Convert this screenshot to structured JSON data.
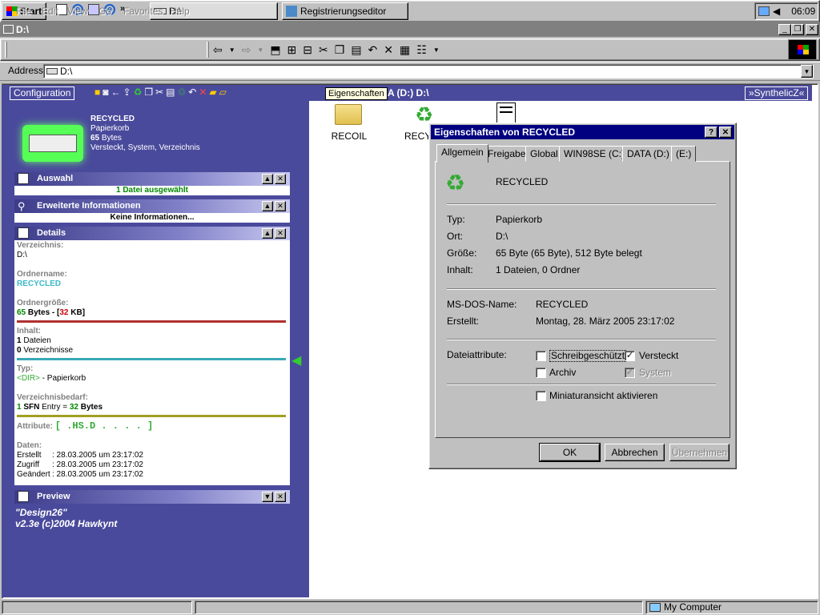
{
  "taskbar": {
    "start": "Start",
    "tasks": [
      "D:\\",
      "Registrierungseditor"
    ],
    "clock": "06:09"
  },
  "window": {
    "title": "D:\\"
  },
  "menu": [
    "File",
    "Edit",
    "View",
    "Go",
    "Favorites",
    "Help"
  ],
  "address": {
    "label": "Address",
    "value": "D:\\"
  },
  "band": {
    "config": "Configuration",
    "tooltip": "Eigenschaften",
    "path": "A (D:) D:\\",
    "synth": "»SynthelicZ«"
  },
  "folder": {
    "name": "RECYCLED",
    "type": "Papierkorb",
    "size_num": "65",
    "size_unit": "Bytes",
    "attrs": "Versteckt, System, Verzeichnis"
  },
  "panels": {
    "auswahl": {
      "title": "Auswahl",
      "text": "1 Datei ausgewählt"
    },
    "erweitert": {
      "title": "Erweiterte Informationen",
      "text": "Keine Informationen..."
    },
    "details": {
      "title": "Details",
      "verz_label": "Verzeichnis:",
      "verz_value": "D:\\",
      "name_label": "Ordnername:",
      "name_value": "RECYCLED",
      "groesse_label": "Ordnergröße:",
      "groesse_a": "65",
      "groesse_b": " Bytes - [",
      "groesse_c": "32",
      "groesse_d": " KB]",
      "inhalt_label": "Inhalt:",
      "inhalt_1a": "1",
      "inhalt_1b": " Dateien",
      "inhalt_2a": "0",
      "inhalt_2b": " Verzeichnisse",
      "typ_label": "Typ:",
      "typ_a": "<DIR>",
      "typ_b": " - Papierkorb",
      "bedarf_label": "Verzeichnisbedarf:",
      "bedarf_a": "1",
      "bedarf_b": " SFN ",
      "bedarf_c": "Entry = ",
      "bedarf_d": "32",
      "bedarf_e": " Bytes",
      "attr_label": "Attribute:",
      "attr_value": "[ .HS.D . . . . ]",
      "daten_label": "Daten:",
      "dates": [
        {
          "k": "Erstellt",
          "v": ": 28.03.2005 um 23:17:02"
        },
        {
          "k": "Zugriff",
          "v": ": 28.03.2005 um 23:17:02"
        },
        {
          "k": "Geändert",
          "v": ": 28.03.2005 um 23:17:02"
        }
      ]
    },
    "preview": {
      "title": "Preview",
      "line1": "\"Design26\"",
      "line2": "v2.3e (c)2004 Hawkynt"
    }
  },
  "icons": [
    {
      "label": "RECOIL"
    },
    {
      "label": "RECY"
    }
  ],
  "dialog": {
    "title": "Eigenschaften von RECYCLED",
    "tabs": [
      "Allgemein",
      "Freigabe",
      "Global",
      "WIN98SE (C:)",
      "DATA (D:)",
      "(E:)"
    ],
    "name": "RECYCLED",
    "rows": [
      {
        "k": "Typ:",
        "v": "Papierkorb"
      },
      {
        "k": "Ort:",
        "v": "D:\\"
      },
      {
        "k": "Größe:",
        "v": "65 Byte (65 Byte), 512 Byte belegt"
      },
      {
        "k": "Inhalt:",
        "v": "1 Dateien, 0 Ordner"
      }
    ],
    "dos_label": "MS-DOS-Name:",
    "dos_value": "RECYCLED",
    "created_label": "Erstellt:",
    "created_value": "Montag, 28. März 2005 23:17:02",
    "attr_label": "Dateiattribute:",
    "cb": {
      "ro": "Schreibgeschützt",
      "hidden": "Versteckt",
      "archive": "Archiv",
      "system": "System",
      "thumb": "Miniaturansicht aktivieren"
    },
    "ok": "OK",
    "cancel": "Abbrechen",
    "apply": "Übernehmen"
  },
  "statusbar": {
    "text": "My Computer"
  }
}
